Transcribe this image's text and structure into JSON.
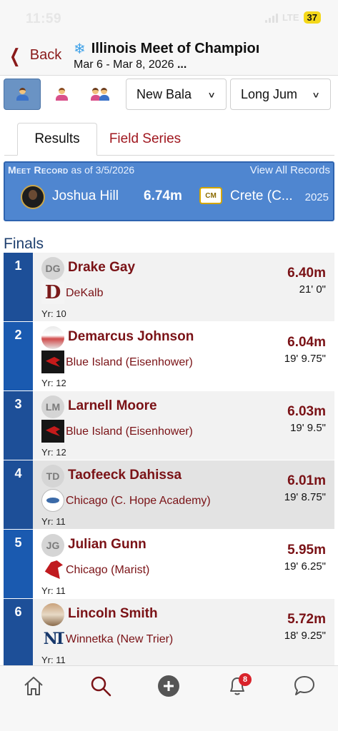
{
  "status_bar": {
    "time": "11:59",
    "network": "LTE",
    "battery": "37"
  },
  "header": {
    "back_label": "Back",
    "meet_title": "Illinois Meet of Champioı",
    "meet_dates": "Mar 6 - Mar 8, 2026",
    "ellipsis": "..."
  },
  "filters": {
    "gender_options": [
      "boys",
      "girls",
      "combined"
    ],
    "selected_gender": "boys",
    "meet_select": "New Bala",
    "event_select": "Long Jum"
  },
  "tabs": [
    {
      "label": "Results",
      "active": true
    },
    {
      "label": "Field Series",
      "active": false
    }
  ],
  "meet_record": {
    "heading": "Meet Record",
    "as_of": "as of 3/5/2026",
    "view_all": "View All Records",
    "athlete": "Joshua Hill",
    "mark": "6.74m",
    "school": "Crete (C...",
    "school_logo_text": "CM",
    "year": "2025"
  },
  "section_title": "Finals",
  "results": [
    {
      "place": "1",
      "initials": "DG",
      "athlete": "Drake Gay",
      "school": "DeKalb",
      "year": "Yr: 10",
      "mark": "6.40m",
      "feet": "21' 0\""
    },
    {
      "place": "2",
      "initials": "",
      "athlete": "Demarcus Johnson",
      "school": "Blue Island (Eisenhower)",
      "year": "Yr: 12",
      "mark": "6.04m",
      "feet": "19' 9.75\""
    },
    {
      "place": "3",
      "initials": "LM",
      "athlete": "Larnell Moore",
      "school": "Blue Island (Eisenhower)",
      "year": "Yr: 12",
      "mark": "6.03m",
      "feet": "19' 9.5\""
    },
    {
      "place": "4",
      "initials": "TD",
      "athlete": "Taofeeck Dahissa",
      "school": "Chicago (C. Hope Academy)",
      "year": "Yr: 11",
      "mark": "6.01m",
      "feet": "19' 8.75\""
    },
    {
      "place": "5",
      "initials": "JG",
      "athlete": "Julian Gunn",
      "school": "Chicago (Marist)",
      "year": "Yr: 11",
      "mark": "5.95m",
      "feet": "19' 6.25\""
    },
    {
      "place": "6",
      "initials": "",
      "athlete": "Lincoln Smith",
      "school": "Winnetka (New Trier)",
      "year": "Yr: 11",
      "mark": "5.72m",
      "feet": "18' 9.25\""
    }
  ],
  "school_logos": {
    "dekalb": "D",
    "new_trier": "NT"
  },
  "bottom_nav": {
    "items": [
      "home-icon",
      "search-icon",
      "add-icon",
      "notifications-icon",
      "messages-icon"
    ],
    "notification_count": "8"
  },
  "colors": {
    "accent": "#7a1216",
    "record_bg": "#4f86d0",
    "place_bg": "#1d4f98"
  }
}
